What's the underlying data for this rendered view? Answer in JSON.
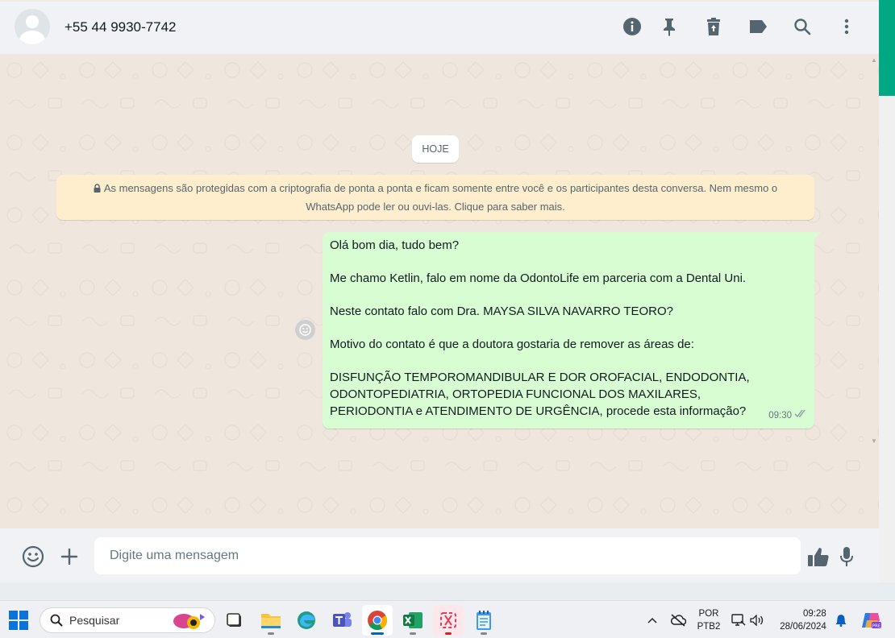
{
  "header": {
    "contact_name": "+55 44 9930-7742",
    "icons": [
      "info-icon",
      "pin-icon",
      "delete-icon",
      "label-icon",
      "search-icon",
      "menu-icon"
    ]
  },
  "chat": {
    "date_chip": "HOJE",
    "encryption_notice": "As mensagens são protegidas com a criptografia de ponta a ponta e ficam somente entre você e os participantes desta conversa. Nem mesmo o WhatsApp pode ler ou ouvi-las. Clique para saber mais.",
    "message": {
      "lines": [
        "Olá bom dia, tudo bem?",
        "Me chamo Ketlin, falo em nome da OdontoLife em parceria com a Dental Uni.",
        "Neste contato falo com Dra. MAYSA SILVA NAVARRO TEORO?",
        "Motivo do contato é que a doutora gostaria de remover as áreas de:",
        "DISFUNÇÃO TEMPOROMANDIBULAR E DOR OROFACIAL, ENDODONTIA, ODONTOPEDIATRIA, ORTOPEDIA FUNCIONAL DOS MAXILARES, PERIODONTIA e ATENDIMENTO DE URGÊNCIA, procede esta informação?"
      ],
      "time": "09:30",
      "status": "delivered"
    }
  },
  "composer": {
    "placeholder": "Digite uma mensagem"
  },
  "taskbar": {
    "search_label": "Pesquisar",
    "apps": [
      "task-view",
      "file-explorer",
      "edge",
      "teams",
      "chrome",
      "excel",
      "snipping-tool",
      "notepad"
    ],
    "active_app": "chrome",
    "language_line1": "POR",
    "language_line2": "PTB2",
    "time": "09:28",
    "date": "28/06/2024"
  },
  "colors": {
    "accent": "#00a884",
    "bubble_out": "#d9fdd3",
    "notice_bg": "#ffeecd",
    "chat_bg": "#efe7dd"
  }
}
